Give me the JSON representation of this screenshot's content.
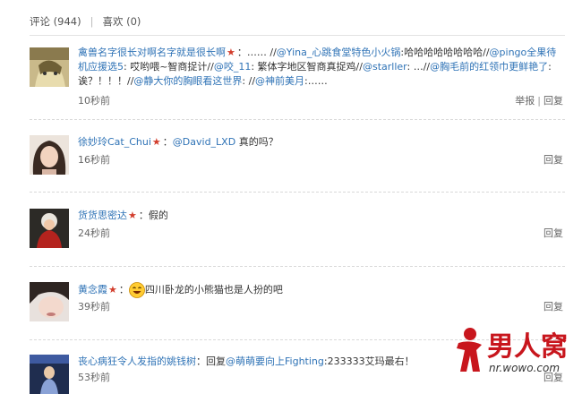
{
  "tabs": {
    "comments": "评论 (944)",
    "likes": "喜欢 (0)",
    "separator": "|"
  },
  "actions": {
    "report": "举报",
    "separator": "|",
    "reply": "回复"
  },
  "comments": [
    {
      "user": "禽兽名字很长对啊名字就是很长啊",
      "colon": "：",
      "segments": [
        {
          "t": "text",
          "v": "…… //"
        },
        {
          "t": "mention",
          "v": "@Yina_心跳食堂特色小火锅"
        },
        {
          "t": "text",
          "v": ":哈哈哈哈哈哈哈哈//"
        },
        {
          "t": "mention",
          "v": "@pingo全果待机应援选5"
        },
        {
          "t": "text",
          "v": ": 哎哟喂~智商捉计//"
        },
        {
          "t": "mention",
          "v": "@咬_11"
        },
        {
          "t": "text",
          "v": ": 繁体字地区智商真捉鸡//"
        },
        {
          "t": "mention",
          "v": "@starller"
        },
        {
          "t": "text",
          "v": ": …//"
        },
        {
          "t": "mention",
          "v": "@胸毛前的红领巾更鲜艳了"
        },
        {
          "t": "text",
          "v": ": 诶？！！！//"
        },
        {
          "t": "mention",
          "v": "@静大你的胸眼看这世界"
        },
        {
          "t": "text",
          "v": ": //"
        },
        {
          "t": "mention",
          "v": "@神前美月"
        },
        {
          "t": "text",
          "v": ":……"
        }
      ],
      "time": "10秒前",
      "has_report": true
    },
    {
      "user": "徐妙玲Cat_Chui",
      "colon": "：",
      "segments": [
        {
          "t": "mention",
          "v": "@David_LXD"
        },
        {
          "t": "text",
          "v": " 真的吗？"
        }
      ],
      "time": "16秒前",
      "has_report": false
    },
    {
      "user": "货货思密达",
      "colon": "：",
      "segments": [
        {
          "t": "text",
          "v": "假的"
        }
      ],
      "time": "24秒前",
      "has_report": false
    },
    {
      "user": "黄念霞",
      "colon": "：",
      "segments": [
        {
          "t": "emoji",
          "v": "laughing-emoji"
        },
        {
          "t": "text",
          "v": "四川卧龙的小熊猫也是人扮的吧"
        }
      ],
      "time": "39秒前",
      "has_report": false
    },
    {
      "user": "丧心病狂令人发指的姚钱树",
      "colon": "：",
      "segments": [
        {
          "t": "text",
          "v": "回复"
        },
        {
          "t": "mention",
          "v": "@萌萌要向上Fighting"
        },
        {
          "t": "text",
          "v": ":233333艾玛最右！"
        }
      ],
      "time": "53秒前",
      "has_report": false
    }
  ],
  "logo": {
    "text": "男人窝",
    "url": "nr.wowo.com"
  },
  "colors": {
    "link": "#2f73b6",
    "star": "#d23d2c",
    "logo_red": "#c8161d"
  }
}
